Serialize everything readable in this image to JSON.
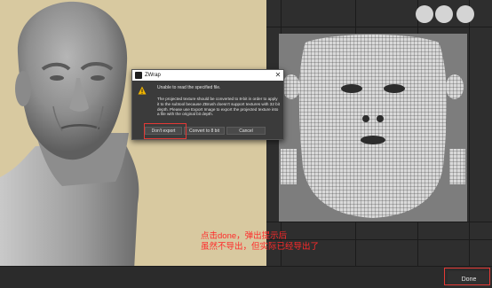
{
  "dialog": {
    "title": "ZWrap",
    "message_heading": "Unable to read the specified file.",
    "message_body": "The projected texture should be converted to 8-bit in order to apply it to the subtool because ZBrush doesn't support textures with 32 bit depth. Please use Export Image to export the projected texture into a file with the original bit depth.",
    "buttons": {
      "dont_export": "Don't export",
      "convert": "Convert to 8 bit",
      "cancel": "Cancel"
    },
    "close_glyph": "✕",
    "icons": [
      "app-icon",
      "warning-icon"
    ]
  },
  "annotation": {
    "line1": "点击done，弹出提示后",
    "line2": "虽然不导出，但实际已经导出了",
    "color": "#ff2a2a"
  },
  "toolbar": {
    "done_label": "Done"
  },
  "colors": {
    "viewport_bg": "#d8c9a0",
    "uv_bg": "#2e2e2e",
    "highlight": "#e53935"
  }
}
